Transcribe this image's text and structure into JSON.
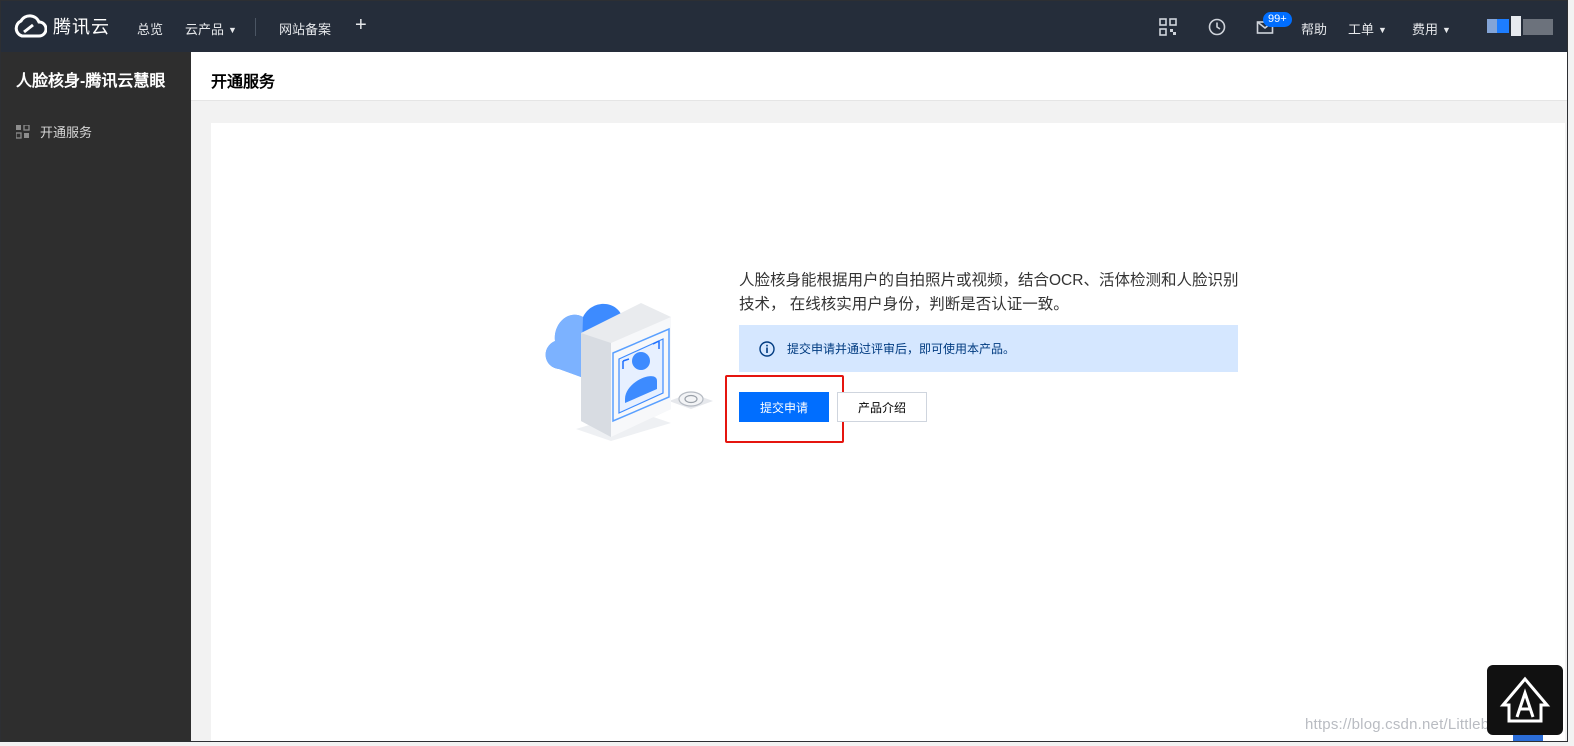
{
  "topnav": {
    "brand": "腾讯云",
    "overview": "总览",
    "products": "云产品",
    "icp": "网站备案",
    "badge": "99+",
    "help": "帮助",
    "ticket": "工单",
    "billing": "费用"
  },
  "sidebar": {
    "title": "人脸核身-腾讯云慧眼",
    "items": [
      {
        "label": "开通服务"
      }
    ]
  },
  "header": {
    "title": "开通服务"
  },
  "main": {
    "description": "人脸核身能根据用户的自拍照片或视频，结合OCR、活体检测和人脸识别技术， 在线核实用户身份，判断是否认证一致。",
    "notice": "提交申请并通过评审后，即可使用本产品。",
    "apply_button": "提交申请",
    "intro_button": "产品介绍"
  },
  "watermark": "https://blog.csdn.net/Littlebearaa",
  "colors": {
    "nav_bg": "#252d3a",
    "sidebar_bg": "#2e2e2e",
    "accent": "#006eff",
    "notice_bg": "#d5e7ff",
    "highlight": "#e5150f"
  }
}
